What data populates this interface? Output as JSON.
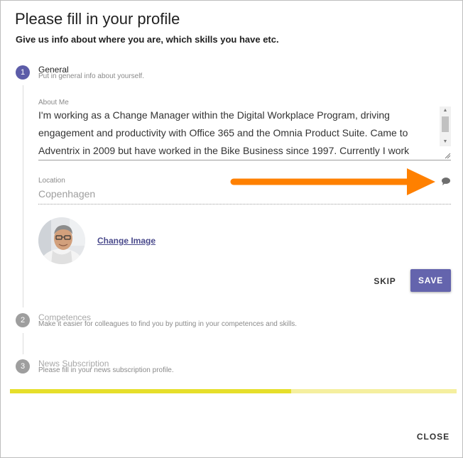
{
  "dialog": {
    "title": "Please fill in your profile",
    "subtitle": "Give us info about where you are, which skills you have etc.",
    "close_label": "CLOSE"
  },
  "steps": [
    {
      "number": "1",
      "title": "General",
      "subtitle": "Put in general info about yourself.",
      "state": "active"
    },
    {
      "number": "2",
      "title": "Competences",
      "subtitle": "Make it easier for colleagues to find you by putting in your competences and skills.",
      "state": "inactive"
    },
    {
      "number": "3",
      "title": "News Subscription",
      "subtitle": "Please fill in your news subscription profile.",
      "state": "inactive"
    }
  ],
  "general": {
    "about_label": "About Me",
    "about_value": "I'm working as a Change Manager within the Digital Workplace Program, driving engagement and productivity with Office 365 and the Omnia Product Suite. Came to Adventrix in 2009 but have worked in the Bike Business since 1997. Currently I work",
    "location_label": "Location",
    "location_value": "Copenhagen",
    "change_image_label": "Change Image",
    "skip_label": "SKIP",
    "save_label": "SAVE"
  },
  "progress": {
    "value": 0.63
  },
  "icons": {
    "comment": "comment-icon",
    "annotation_arrow": "arrow-right"
  },
  "colors": {
    "accent": "#6464ad",
    "step_active": "#5c5ca8",
    "annotation_arrow": "#ff8000",
    "progress_fill": "#e6df2a",
    "progress_track": "#f5ef9f"
  }
}
